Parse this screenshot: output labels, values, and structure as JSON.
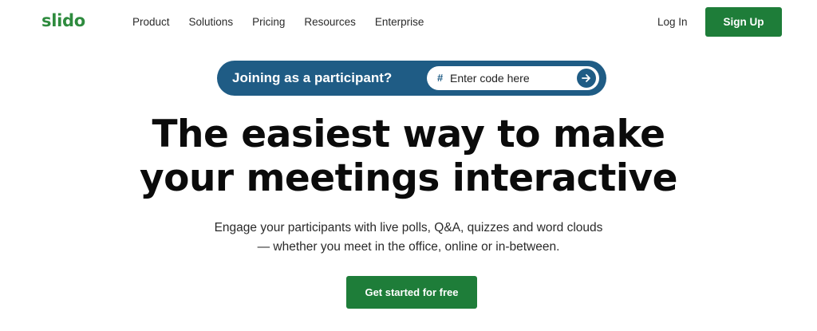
{
  "header": {
    "logo": "slido",
    "nav": [
      "Product",
      "Solutions",
      "Pricing",
      "Resources",
      "Enterprise"
    ],
    "login": "Log In",
    "signup": "Sign Up"
  },
  "join": {
    "label": "Joining as a participant?",
    "hash": "#",
    "placeholder": "Enter code here",
    "submit_icon": "arrow-right-icon"
  },
  "hero": {
    "headline_line1": "The easiest way to make",
    "headline_line2": "your meetings interactive",
    "sub_line1": "Engage your participants with live polls, Q&A, quizzes and word clouds",
    "sub_line2": "— whether you meet in the office, online or in-between.",
    "cta": "Get started for free"
  },
  "colors": {
    "brand_green": "#1e7d39",
    "logo_green": "#2e8b3e",
    "join_blue": "#1f5c85"
  }
}
